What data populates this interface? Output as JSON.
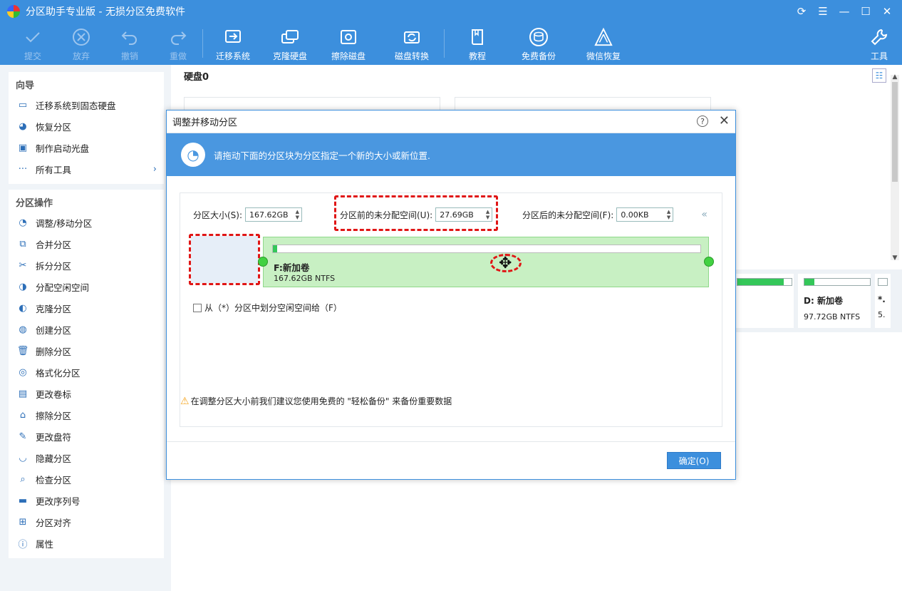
{
  "window": {
    "title": "分区助手专业版 - 无损分区免费软件",
    "controls": [
      "refresh-icon",
      "menu-icon",
      "minimize-icon",
      "maximize-icon",
      "close-icon"
    ]
  },
  "toolbar": {
    "commit": "提交",
    "discard": "放弃",
    "undo": "撤销",
    "redo": "重做",
    "migrate": "迁移系统",
    "clone": "克隆硬盘",
    "wipe": "擦除磁盘",
    "convert": "磁盘转换",
    "tutorial": "教程",
    "backup": "免费备份",
    "wechat": "微信恢复",
    "tools": "工具"
  },
  "sidebar": {
    "wizard_title": "向导",
    "wizard_items": [
      {
        "label": "迁移系统到固态硬盘",
        "icon": "ssd-icon"
      },
      {
        "label": "恢复分区",
        "icon": "restore-icon"
      },
      {
        "label": "制作启动光盘",
        "icon": "bootdisk-icon"
      },
      {
        "label": "所有工具",
        "icon": "more-icon"
      }
    ],
    "ops_title": "分区操作",
    "ops_items": [
      {
        "label": "调整/移动分区",
        "icon": "resize-icon"
      },
      {
        "label": "合并分区",
        "icon": "merge-icon"
      },
      {
        "label": "拆分分区",
        "icon": "split-icon"
      },
      {
        "label": "分配空闲空间",
        "icon": "allocate-icon"
      },
      {
        "label": "克隆分区",
        "icon": "clone-icon"
      },
      {
        "label": "创建分区",
        "icon": "create-icon"
      },
      {
        "label": "删除分区",
        "icon": "delete-icon"
      },
      {
        "label": "格式化分区",
        "icon": "format-icon"
      },
      {
        "label": "更改卷标",
        "icon": "label-icon"
      },
      {
        "label": "擦除分区",
        "icon": "wipe-icon"
      },
      {
        "label": "更改盘符",
        "icon": "letter-icon"
      },
      {
        "label": "隐藏分区",
        "icon": "hide-icon"
      },
      {
        "label": "检查分区",
        "icon": "check-icon"
      },
      {
        "label": "更改序列号",
        "icon": "serial-icon"
      },
      {
        "label": "分区对齐",
        "icon": "align-icon"
      },
      {
        "label": "属性",
        "icon": "info-icon"
      }
    ]
  },
  "main": {
    "disk_title": "硬盘0",
    "partitions_right": [
      {
        "name": "",
        "size": "",
        "fill": 0.85
      },
      {
        "name": "D: 新加卷",
        "size": "97.72GB NTFS",
        "fill": 0.15
      },
      {
        "name": "*.",
        "size": "5.",
        "fill": 0
      }
    ]
  },
  "dialog": {
    "title": "调整并移动分区",
    "banner_text": "请拖动下面的分区块为分区指定一个新的大小或新位置.",
    "size_label": "分区大小(S):",
    "size_value": "167.62GB",
    "before_label": "分区前的未分配空间(U):",
    "before_value": "27.69GB",
    "after_label": "分区后的未分配空间(F):",
    "after_value": "0.00KB",
    "partition_name": "F:新加卷",
    "partition_size": "167.62GB NTFS",
    "partition_fill": 0.01,
    "checkbox_label": "从（*）分区中划分空闲空间给（F）",
    "warning_text": "在调整分区大小前我们建议您使用免费的 \"轻松备份\" 来备份重要数据",
    "ok_label": "确定(O)"
  }
}
